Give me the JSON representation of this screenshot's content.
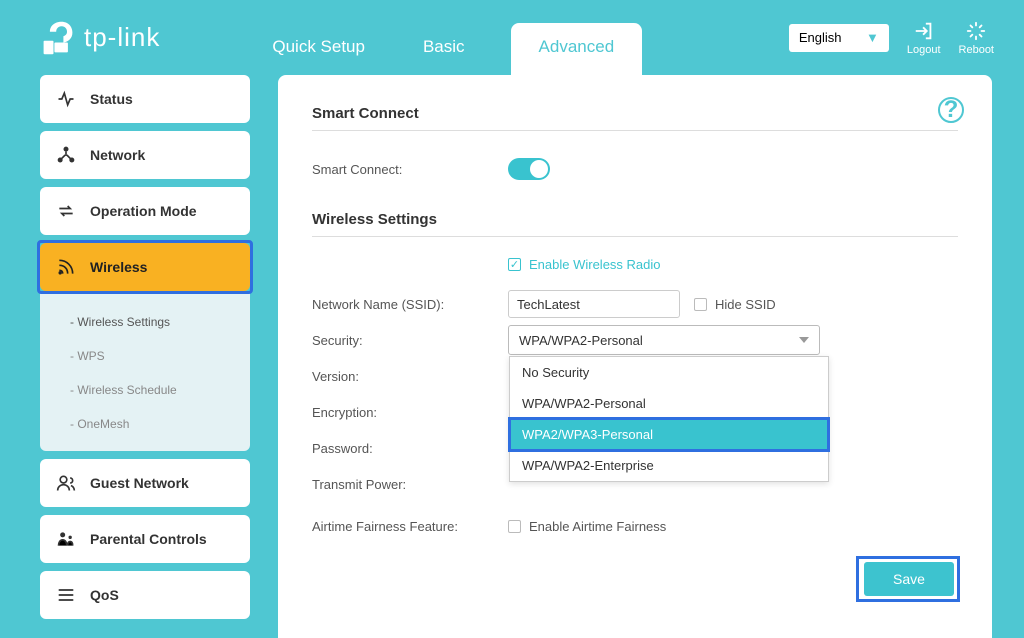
{
  "brand": "tp-link",
  "tabs": {
    "quick": "Quick Setup",
    "basic": "Basic",
    "advanced": "Advanced"
  },
  "header": {
    "language": "English",
    "logout": "Logout",
    "reboot": "Reboot"
  },
  "sidebar": {
    "status": "Status",
    "network": "Network",
    "operation_mode": "Operation Mode",
    "wireless": "Wireless",
    "sub": {
      "wireless_settings": "Wireless Settings",
      "wps": "WPS",
      "wireless_schedule": "Wireless Schedule",
      "onemesh": "OneMesh"
    },
    "guest": "Guest Network",
    "parental": "Parental Controls",
    "qos": "QoS"
  },
  "panel": {
    "section1_title": "Smart Connect",
    "smart_connect_label": "Smart Connect:",
    "smart_connect_on": true,
    "section2_title": "Wireless Settings",
    "enable_radio": "Enable Wireless Radio",
    "enable_radio_checked": true,
    "ssid_label": "Network Name (SSID):",
    "ssid_value": "TechLatest",
    "hide_ssid": "Hide SSID",
    "hide_ssid_checked": false,
    "security_label": "Security:",
    "security_value": "WPA/WPA2-Personal",
    "security_options": [
      "No Security",
      "WPA/WPA2-Personal",
      "WPA2/WPA3-Personal",
      "WPA/WPA2-Enterprise"
    ],
    "security_highlighted_index": 2,
    "version_label": "Version:",
    "encryption_label": "Encryption:",
    "password_label": "Password:",
    "transmit_label": "Transmit Power:",
    "airtime_label": "Airtime Fairness Feature:",
    "airtime_checkbox": "Enable Airtime Fairness",
    "airtime_checked": false,
    "save": "Save"
  }
}
